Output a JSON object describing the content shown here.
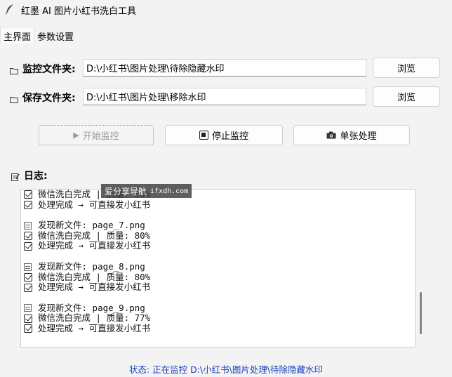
{
  "window": {
    "title": "红墨 AI 图片小红书洗白工具",
    "icon": "feather-icon"
  },
  "tabs": [
    {
      "label": "主界面",
      "active": true
    },
    {
      "label": "参数设置",
      "active": false
    }
  ],
  "monitor": {
    "label": "监控文件夹:",
    "path": "D:\\小红书\\图片处理\\待除隐藏水印",
    "browse_label": "浏览"
  },
  "save": {
    "label": "保存文件夹:",
    "path": "D:\\小红书\\图片处理\\移除水印",
    "browse_label": "浏览"
  },
  "actions": {
    "start": {
      "icon": "▶",
      "label": "开始监控",
      "enabled": false
    },
    "stop": {
      "icon": "■",
      "label": "停止监控",
      "enabled": true
    },
    "single": {
      "icon": "📷",
      "label": "单张处理",
      "enabled": true
    }
  },
  "log": {
    "label": "日志:",
    "lines": [
      {
        "type": "check",
        "text": "微信洗白完成 | 质量: 80%"
      },
      {
        "type": "check",
        "text": "处理完成 → 可直接发小红书"
      },
      {
        "type": "blank",
        "text": ""
      },
      {
        "type": "doc",
        "text": "发现新文件: page_7.png"
      },
      {
        "type": "check",
        "text": "微信洗白完成 | 质量: 80%"
      },
      {
        "type": "check",
        "text": "处理完成 → 可直接发小红书"
      },
      {
        "type": "blank",
        "text": ""
      },
      {
        "type": "doc",
        "text": "发现新文件: page_8.png"
      },
      {
        "type": "check",
        "text": "微信洗白完成 | 质量: 80%"
      },
      {
        "type": "check",
        "text": "处理完成 → 可直接发小红书"
      },
      {
        "type": "blank",
        "text": ""
      },
      {
        "type": "doc",
        "text": "发现新文件: page_9.png"
      },
      {
        "type": "check",
        "text": "微信洗白完成 | 质量: 77%"
      },
      {
        "type": "check",
        "text": "处理完成 → 可直接发小红书"
      }
    ]
  },
  "watermark": {
    "text": "爱分享导航",
    "url": "ifxdh.com"
  },
  "status": {
    "text": "状态: 正在监控 D:\\小红书\\图片处理\\待除隐藏水印",
    "color": "#1a3fbf"
  }
}
